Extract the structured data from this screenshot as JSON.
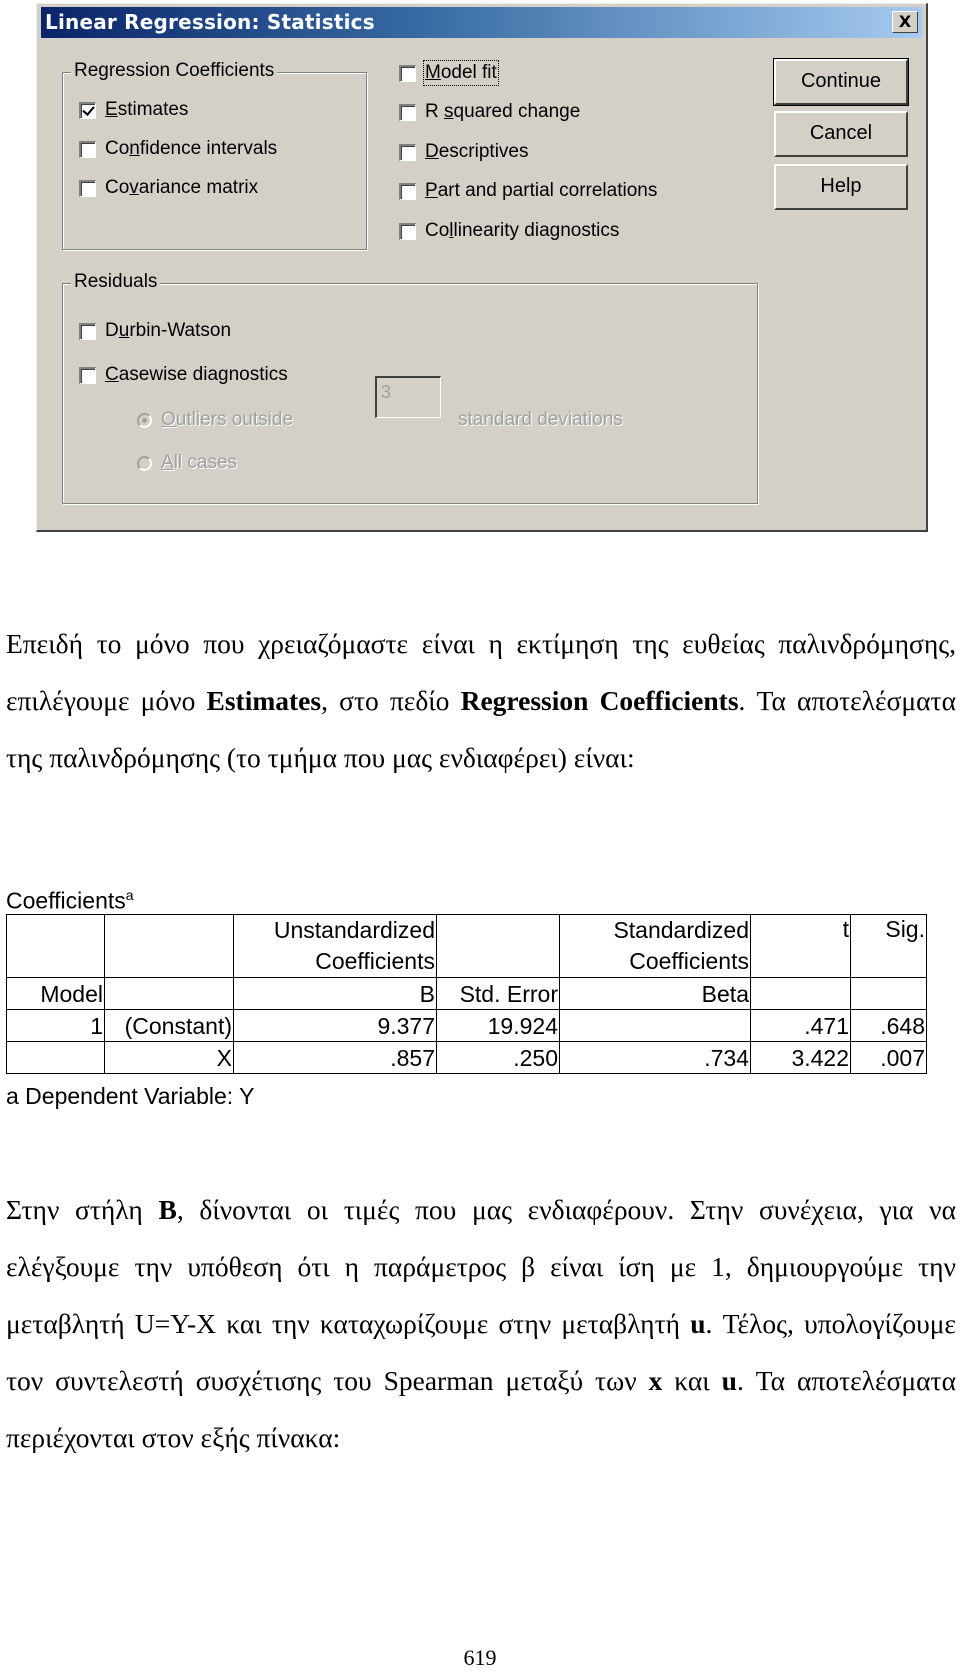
{
  "dialog": {
    "title": "Linear Regression: Statistics",
    "close_label": "X",
    "regression_coefficients": {
      "label": "Regression Coefficients",
      "items": [
        {
          "label_pre": "",
          "accel": "E",
          "label_post": "stimates",
          "checked": true
        },
        {
          "label_pre": "Co",
          "accel": "n",
          "label_post": "fidence intervals",
          "checked": false
        },
        {
          "label_pre": "Co",
          "accel": "v",
          "label_post": "ariance matrix",
          "checked": false
        }
      ]
    },
    "options": [
      {
        "label_pre": "",
        "accel": "M",
        "label_post": "odel fit",
        "checked": false,
        "focused": true
      },
      {
        "label_pre": "R ",
        "accel": "s",
        "label_post": "quared change",
        "checked": false
      },
      {
        "label_pre": "",
        "accel": "D",
        "label_post": "escriptives",
        "checked": false
      },
      {
        "label_pre": "",
        "accel": "P",
        "label_post": "art and partial correlations",
        "checked": false
      },
      {
        "label_pre": "Co",
        "accel": "l",
        "label_post": "linearity diagnostics",
        "checked": false
      }
    ],
    "buttons": {
      "continue": "Continue",
      "cancel": "Cancel",
      "help": "Help"
    },
    "residuals": {
      "label": "Residuals",
      "durbin_watson": {
        "label_pre": "D",
        "accel": "u",
        "label_post": "rbin-Watson",
        "checked": false
      },
      "casewise": {
        "label_pre": "",
        "accel": "C",
        "label_post": "asewise diagnostics",
        "checked": false
      },
      "outliers": {
        "label_pre": "",
        "accel": "O",
        "label_post": "utliers outside",
        "selected": true,
        "enabled": false
      },
      "sd_value": "3",
      "sd_label": "standard deviations",
      "all_cases": {
        "label_pre": "",
        "accel": "A",
        "label_post": "ll cases",
        "selected": false,
        "enabled": false
      }
    }
  },
  "text1": {
    "p1": "Επειδή το μόνο που χρειαζόμαστε είναι η εκτίμηση της ευθείας παλινδρόμησης, επιλέγουμε μόνο ",
    "b1": "Estimates",
    "p2": ", στο πεδίο ",
    "b2": "Regression Coefficients",
    "p3": ". Τα αποτελέσματα της παλινδρόμησης (το τμήμα που μας ενδιαφέρει) είναι:"
  },
  "table": {
    "title": "Coefficients",
    "title_sup": "a",
    "header1": [
      "",
      "",
      "Unstandardized Coefficients",
      "",
      "Standardized Coefficients",
      "t",
      "Sig."
    ],
    "header2": [
      "Model",
      "",
      "B",
      "Std. Error",
      "Beta",
      "",
      ""
    ],
    "rows": [
      [
        "1",
        "(Constant)",
        "9.377",
        "19.924",
        "",
        ".471",
        ".648"
      ],
      [
        "",
        "X",
        ".857",
        ".250",
        ".734",
        "3.422",
        ".007"
      ]
    ],
    "footnote": "a  Dependent Variable: Y"
  },
  "text2": {
    "p1": "Στην στήλη ",
    "b1": "B",
    "p2": ", δίνονται οι τιμές που μας ενδιαφέρουν. Στην συνέχεια, για να ελέγξουμε την υπόθεση ότι η παράμετρος β είναι ίση με 1, δημιουργούμε την μεταβλητή U=Y-X και την καταχωρίζουμε στην μεταβλητή ",
    "b2": "u",
    "p3": ". Τέλος, υπολογίζουμε τον συντελεστή συσχέτισης του Spearman μεταξύ των ",
    "b3": "x",
    "p4": " και ",
    "b4": "u",
    "p5": ". Τα αποτελέσματα περιέχονται στον εξής πίνακα:"
  },
  "page_number": "619"
}
